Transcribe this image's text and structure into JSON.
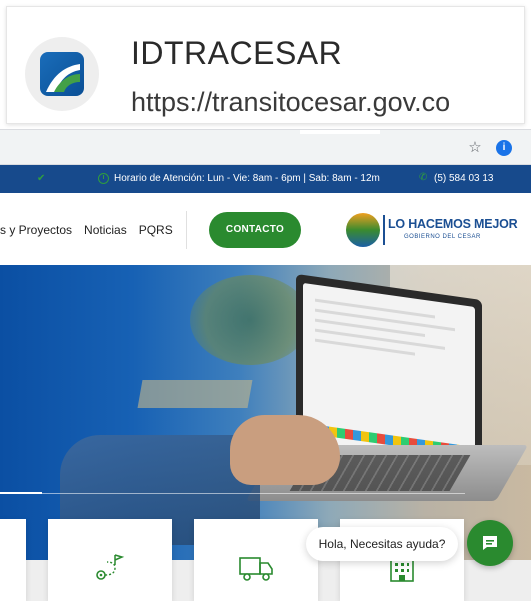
{
  "site_card": {
    "title": "IDTRACESAR",
    "url": "https://transitocesar.gov.co"
  },
  "browser": {
    "star_icon": "star-icon",
    "info_badge": "i"
  },
  "info_bar": {
    "hours": "Horario de Atención: Lun - Vie: 8am - 6pm | Sab: 8am - 12m",
    "phone": "(5) 584 03 13"
  },
  "nav": {
    "links": [
      "s y Proyectos",
      "Noticias",
      "PQRS"
    ],
    "contact_label": "CONTACTO",
    "logo_title": "LO HACEMOS MEJOR",
    "logo_subtitle": "GOBIERNO DEL CESAR"
  },
  "services": {
    "icons": [
      "route-icon",
      "truck-icon",
      "building-icon"
    ]
  },
  "chat": {
    "bubble_text": "Hola, Necesitas ayuda?"
  },
  "colors": {
    "info_bar_bg": "#174a8c",
    "accent_green": "#2a8a2f",
    "brand_blue": "#1b4f93"
  }
}
